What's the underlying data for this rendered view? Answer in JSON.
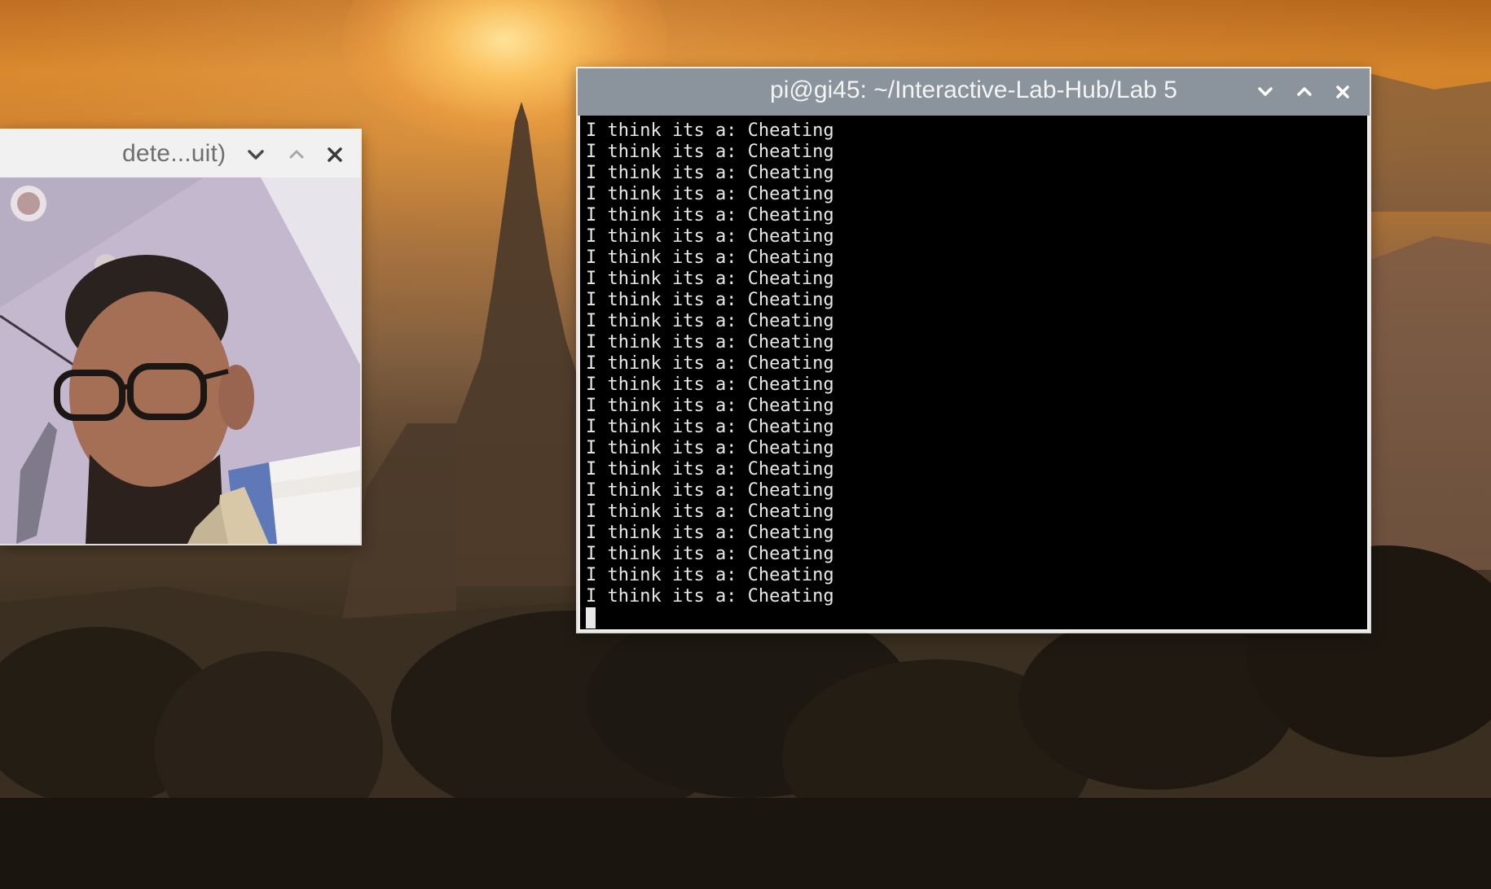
{
  "desktop": {
    "wallpaper": "sunset-temple-landscape"
  },
  "camera_window": {
    "title": "dete...uit)",
    "buttons": {
      "minimize_icon": "chevron-down-icon",
      "maximize_icon": "chevron-up-icon",
      "close_icon": "close-icon"
    },
    "image": "webcam-person-with-glasses"
  },
  "terminal_window": {
    "title": "pi@gi45: ~/Interactive-Lab-Hub/Lab 5",
    "buttons": {
      "minimize_icon": "chevron-down-icon",
      "maximize_icon": "chevron-up-icon",
      "close_icon": "close-icon"
    },
    "lines": [
      "I think its a: Cheating",
      "I think its a: Cheating",
      "I think its a: Cheating",
      "I think its a: Cheating",
      "I think its a: Cheating",
      "I think its a: Cheating",
      "I think its a: Cheating",
      "I think its a: Cheating",
      "I think its a: Cheating",
      "I think its a: Cheating",
      "I think its a: Cheating",
      "I think its a: Cheating",
      "I think its a: Cheating",
      "I think its a: Cheating",
      "I think its a: Cheating",
      "I think its a: Cheating",
      "I think its a: Cheating",
      "I think its a: Cheating",
      "I think its a: Cheating",
      "I think its a: Cheating",
      "I think its a: Cheating",
      "I think its a: Cheating",
      "I think its a: Cheating"
    ]
  },
  "colors": {
    "terminal_titlebar": "#8b939c",
    "terminal_background": "#000000",
    "terminal_text": "#e8e8e8",
    "camera_titlebar": "#f1f1f1"
  }
}
